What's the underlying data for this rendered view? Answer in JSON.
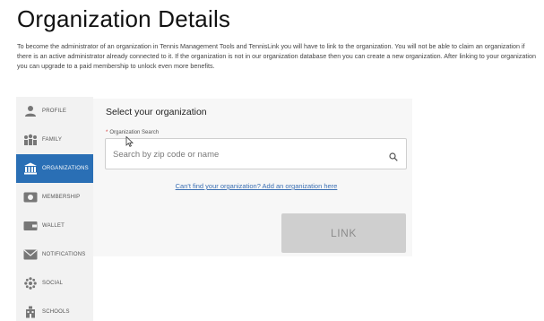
{
  "page": {
    "title": "Organization Details",
    "intro": "To become the administrator of an organization in Tennis Management Tools and TennisLink you will have to link to the organization. You will not be able to claim an organization if there is an active administrator already connected to it. If the organization is not in our organization database then you can create a new organization. After linking to your organization you can upgrade to a paid membership to unlock even more benefits."
  },
  "sidebar": {
    "items": [
      {
        "label": "PROFILE",
        "icon": "person-icon",
        "active": false
      },
      {
        "label": "FAMILY",
        "icon": "family-icon",
        "active": false
      },
      {
        "label": "ORGANIZATIONS",
        "icon": "building-icon",
        "active": true
      },
      {
        "label": "MEMBERSHIP",
        "icon": "membership-card-icon",
        "active": false
      },
      {
        "label": "WALLET",
        "icon": "wallet-icon",
        "active": false
      },
      {
        "label": "NOTIFICATIONS",
        "icon": "notifications-icon",
        "active": false
      },
      {
        "label": "SOCIAL",
        "icon": "social-icon",
        "active": false
      },
      {
        "label": "SCHOOLS",
        "icon": "school-icon",
        "active": false
      }
    ]
  },
  "card": {
    "title": "Select your organization",
    "field_label": "Organization Search",
    "search_placeholder": "Search by zip code or name",
    "search_value": "",
    "cant_find_link": "Can't find your organization? Add an organization here",
    "link_button": "LINK"
  },
  "colors": {
    "accent": "#2a6fb5",
    "link": "#3b6fb3",
    "required": "#d43535",
    "disabled_button": "#cfcfcf"
  }
}
